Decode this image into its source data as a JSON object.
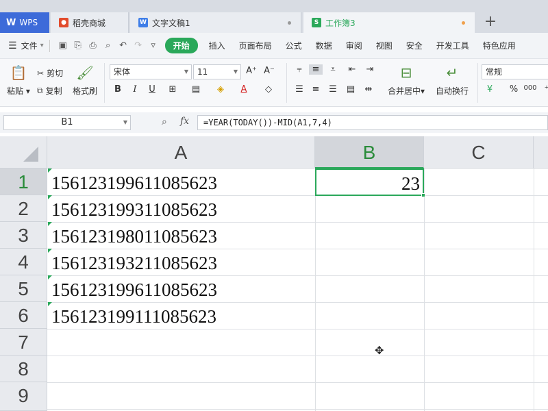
{
  "tabs": {
    "wps": "WPS",
    "doc1": "稻壳商城",
    "doc2": "文字文稿1",
    "active": "工作簿3",
    "new_tab": "+"
  },
  "menu": {
    "file": "文件",
    "start": "开始",
    "items": [
      "插入",
      "页面布局",
      "公式",
      "数据",
      "审阅",
      "视图",
      "安全",
      "开发工具",
      "特色应用"
    ]
  },
  "ribbon": {
    "paste": "粘贴",
    "cut": "剪切",
    "copy": "复制",
    "format_painter": "格式刷",
    "font_name": "宋体",
    "font_size": "11",
    "merge_center": "合并居中",
    "wrap_text": "自动换行",
    "number_format": "常规",
    "percent": "%"
  },
  "formula_bar": {
    "name_box": "B1",
    "fx": "fx",
    "formula": "=YEAR(TODAY())-MID(A1,7,4)"
  },
  "sheet": {
    "columns": [
      "A",
      "B",
      "C"
    ],
    "selected_column": "B",
    "rows": [
      "1",
      "2",
      "3",
      "4",
      "5",
      "6",
      "7",
      "8",
      "9"
    ],
    "a_values": [
      "156123199611085623",
      "156123199311085623",
      "156123198011085623",
      "156123193211085623",
      "156123199611085623",
      "156123199111085623"
    ],
    "b1_value": "23"
  },
  "colors": {
    "accent_green": "#2aa85a",
    "wps_blue": "#3d6bd9"
  }
}
